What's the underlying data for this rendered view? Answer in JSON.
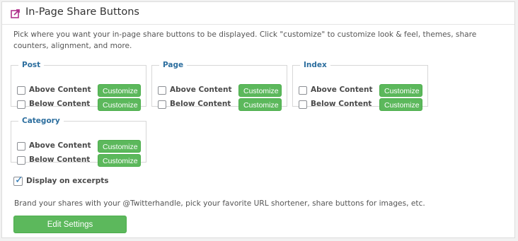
{
  "panel": {
    "title": "In-Page Share Buttons",
    "icon": "share-icon",
    "intro": "Pick where you want your in-page share buttons to be displayed. Click \"customize\" to customize look & feel, themes, share counters, alignment, and more."
  },
  "groups": [
    {
      "legend": "Post",
      "options": [
        {
          "label": "Above Content",
          "checked": false,
          "button": "Customize"
        },
        {
          "label": "Below Content",
          "checked": false,
          "button": "Customize"
        }
      ]
    },
    {
      "legend": "Page",
      "options": [
        {
          "label": "Above Content",
          "checked": false,
          "button": "Customize"
        },
        {
          "label": "Below Content",
          "checked": false,
          "button": "Customize"
        }
      ]
    },
    {
      "legend": "Index",
      "options": [
        {
          "label": "Above Content",
          "checked": false,
          "button": "Customize"
        },
        {
          "label": "Below Content",
          "checked": false,
          "button": "Customize"
        }
      ]
    },
    {
      "legend": "Category",
      "options": [
        {
          "label": "Above Content",
          "checked": false,
          "button": "Customize"
        },
        {
          "label": "Below Content",
          "checked": false,
          "button": "Customize"
        }
      ]
    }
  ],
  "excerpts": {
    "label": "Display on excerpts",
    "checked": true
  },
  "brand_text": "Brand your shares with your @Twitterhandle, pick your favorite URL shortener, share buttons for images, etc.",
  "edit_button": "Edit Settings",
  "colors": {
    "accent_green": "#5cb85c",
    "legend_blue": "#2c6e9e",
    "icon_magenta": "#b0328c",
    "check_blue": "#2271b1"
  }
}
